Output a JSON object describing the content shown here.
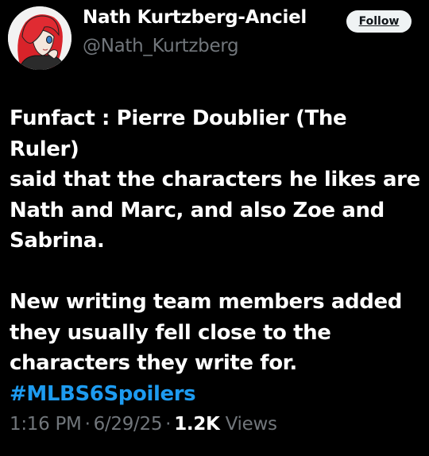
{
  "author": {
    "display_name": "Nath Kurtzberg-Anciel",
    "handle": "@Nath_Kurtzberg",
    "avatar_icon": "profile-avatar-red-hair-character"
  },
  "follow_button": {
    "label": "Follow"
  },
  "tweet": {
    "paragraph_1": "Funfact : Pierre Doublier (The Ruler)\nsaid that the characters he likes are\nNath and Marc, and also Zoe and\nSabrina.",
    "paragraph_2": "New writing team members added\nthey usually fell close to the\ncharacters they write for.",
    "hashtag": "#MLBS6Spoilers"
  },
  "meta": {
    "time": "1:16 PM",
    "separator": "·",
    "date": "6/29/25",
    "views_count": "1.2K",
    "views_label": "Views"
  },
  "colors": {
    "background": "#000000",
    "text_primary": "#ffffff",
    "text_secondary": "#71767b",
    "link": "#1d9bf0",
    "button_bg": "#eff3f4"
  }
}
